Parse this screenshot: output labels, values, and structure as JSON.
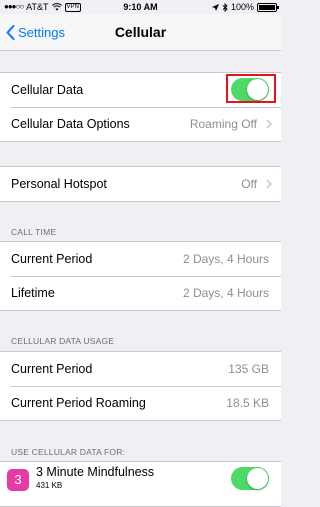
{
  "status_bar": {
    "carrier": "AT&T",
    "vpn": "VPN",
    "time": "9:10 AM",
    "battery": "100%"
  },
  "nav": {
    "back_label": "Settings",
    "title": "Cellular"
  },
  "group1": {
    "cellular_data_label": "Cellular Data",
    "cellular_data_on": true,
    "cellular_data_options_label": "Cellular Data Options",
    "cellular_data_options_value": "Roaming Off"
  },
  "group2": {
    "personal_hotspot_label": "Personal Hotspot",
    "personal_hotspot_value": "Off"
  },
  "call_time": {
    "header": "CALL TIME",
    "current_period_label": "Current Period",
    "current_period_value": "2 Days, 4 Hours",
    "lifetime_label": "Lifetime",
    "lifetime_value": "2 Days, 4 Hours"
  },
  "usage": {
    "header": "CELLULAR DATA USAGE",
    "current_period_label": "Current Period",
    "current_period_value": "135 GB",
    "roaming_label": "Current Period Roaming",
    "roaming_value": "18.5 KB"
  },
  "apps": {
    "header": "USE CELLULAR DATA FOR:",
    "items": [
      {
        "icon_glyph": "3",
        "name": "3 Minute Mindfulness",
        "size": "431 KB",
        "enabled": true
      }
    ]
  },
  "colors": {
    "accent": "#007aff",
    "toggle_on": "#4cd964",
    "highlight": "#e8141b"
  }
}
